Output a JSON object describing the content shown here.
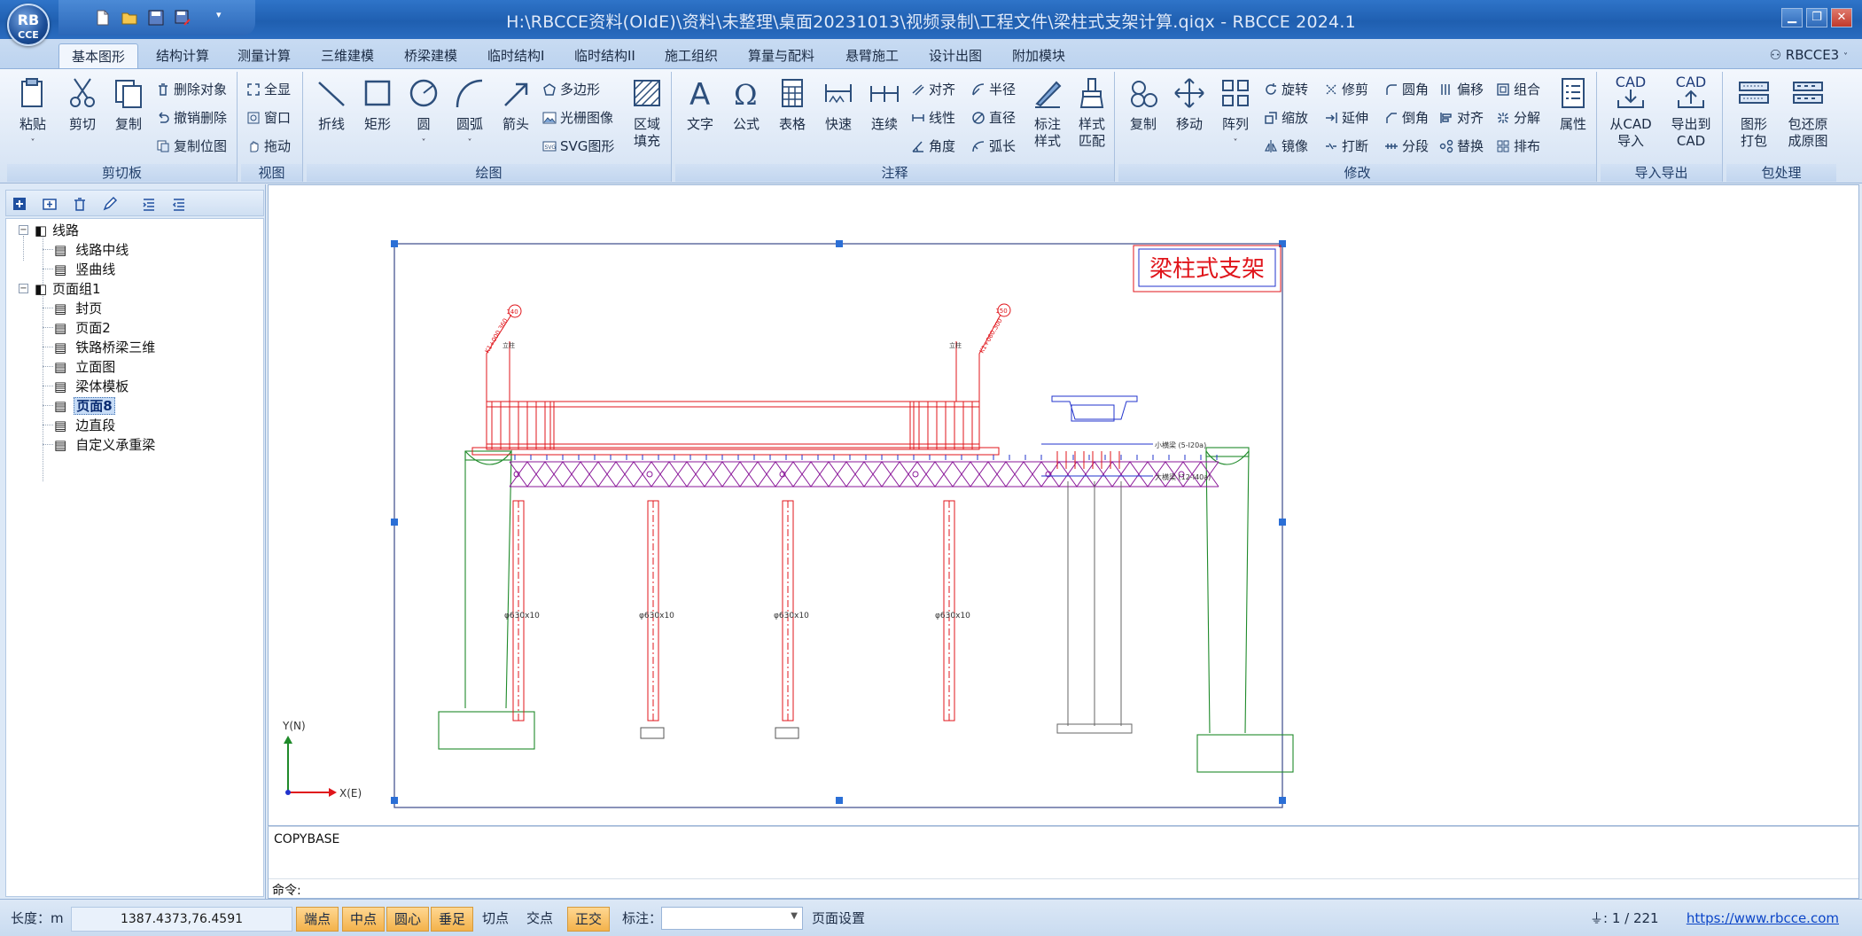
{
  "app": {
    "logo_text": "RB",
    "logo_subtext": "CCE",
    "window_title": "H:\\RBCCE资料(OldE)\\资料\\未整理\\桌面20231013\\视频录制\\工程文件\\梁柱式支架计算.qiqx - RBCCE 2024.1",
    "user": "RBCCE3"
  },
  "quick_access": [
    "new-file-icon",
    "open-folder-icon",
    "save-icon",
    "save-as-icon",
    "customize-dropdown-icon"
  ],
  "ribbon_tabs": [
    "基本图形",
    "结构计算",
    "测量计算",
    "三维建模",
    "桥梁建模",
    "临时结构I",
    "临时结构II",
    "施工组织",
    "算量与配料",
    "悬臂施工",
    "设计出图",
    "附加模块"
  ],
  "active_tab": "基本图形",
  "groups": {
    "clipboard": {
      "label": "剪切板",
      "paste": "粘贴",
      "cut": "剪切",
      "copy": "复制",
      "delete_obj": "删除对象",
      "undo_delete": "撤销删除",
      "copy_pos": "复制位图"
    },
    "view": {
      "label": "视图",
      "full": "全显",
      "window": "窗口",
      "drag": "拖动"
    },
    "draw": {
      "label": "绘图",
      "polyline": "折线",
      "rect": "矩形",
      "circle": "圆",
      "arc": "圆弧",
      "arrow": "箭头",
      "polygon": "多边形",
      "raster": "光栅图像",
      "svg": "SVG图形",
      "fill": "区域",
      "fill2": "填充"
    },
    "annot": {
      "label": "注释",
      "text": "文字",
      "formula": "公式",
      "table": "表格",
      "quick": "快速",
      "continuous": "连续",
      "align": "对齐",
      "linear": "线性",
      "angle": "角度",
      "radius": "半径",
      "diameter": "直径",
      "arclen": "弧长",
      "dim_style": "标注",
      "dim_style2": "样式",
      "match_style": "样式",
      "match_style2": "匹配"
    },
    "modify": {
      "label": "修改",
      "copy": "复制",
      "move": "移动",
      "array": "阵列",
      "rotate": "旋转",
      "scale": "缩放",
      "mirror": "镜像",
      "trim": "修剪",
      "extend": "延伸",
      "break": "打断",
      "fillet": "圆角",
      "chamfer": "倒角",
      "divide": "分段",
      "offset": "偏移",
      "align": "对齐",
      "replace": "替换",
      "group": "组合",
      "explode": "分解",
      "arrange": "排布",
      "props": "属性"
    },
    "io": {
      "label": "导入导出",
      "from_cad": "从CAD",
      "from_cad2": "导入",
      "to_cad": "导出到",
      "to_cad2": "CAD",
      "cad_badge": "CAD"
    },
    "pack": {
      "label": "包处理",
      "pack": "图形",
      "pack2": "打包",
      "restore": "包还原",
      "restore2": "成原图"
    }
  },
  "tree": [
    {
      "label": "线路",
      "level": 0,
      "expanded": true
    },
    {
      "label": "线路中线",
      "level": 1
    },
    {
      "label": "竖曲线",
      "level": 1
    },
    {
      "label": "页面组1",
      "level": 0,
      "expanded": true
    },
    {
      "label": "封页",
      "level": 1
    },
    {
      "label": "页面2",
      "level": 1
    },
    {
      "label": "铁路桥梁三维",
      "level": 1
    },
    {
      "label": "立面图",
      "level": 1
    },
    {
      "label": "梁体模板",
      "level": 1
    },
    {
      "label": "页面8",
      "level": 1,
      "selected": true
    },
    {
      "label": "边直段",
      "level": 1
    },
    {
      "label": "自定义承重梁",
      "level": 1
    }
  ],
  "drawing": {
    "title_block": "梁柱式支架",
    "axis_y": "Y(N)",
    "axis_x": "X(E)",
    "pile_label": "φ630x10",
    "left_note": "K1+000.360",
    "right_note": "K1+060.300",
    "left_tag": "140",
    "right_tag": "150",
    "small_label": "立柱",
    "small_beam": "小横梁 (5-I20a)",
    "big_beam": "大横梁 (12-I40a)"
  },
  "command": {
    "history": "COPYBASE",
    "prompt": "命令:"
  },
  "status": {
    "length_label": "长度：m",
    "coords": "1387.4373,76.4591",
    "snaps": [
      {
        "label": "端点",
        "on": true
      },
      {
        "label": "中点",
        "on": true
      },
      {
        "label": "圆心",
        "on": true
      },
      {
        "label": "垂足",
        "on": true
      },
      {
        "label": "切点",
        "on": false
      },
      {
        "label": "交点",
        "on": false
      }
    ],
    "ortho": "正交",
    "mark_label": "标注：",
    "page_setup": "页面设置",
    "page_info": ": 1 / 221",
    "url": "https://www.rbcce.com"
  },
  "colors": {
    "title_bar": "#1f5fb0",
    "snap_on": "#f3b24b",
    "drawing_red": "#e0151b",
    "drawing_green": "#1f8a2a",
    "drawing_purple": "#8b1a9a",
    "drawing_blue": "#2233cc"
  }
}
